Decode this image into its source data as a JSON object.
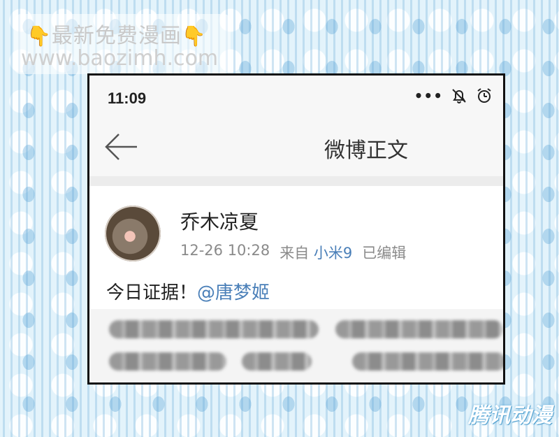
{
  "watermark": {
    "line1": "最新免费漫画",
    "line2": "www.baozimh.com",
    "icon": "pointing-down-hand"
  },
  "status": {
    "time": "11:09",
    "icons": [
      "more-dots-icon",
      "alarm-off-icon",
      "alarm-icon"
    ]
  },
  "nav": {
    "title": "微博正文",
    "back_icon": "back-arrow-icon"
  },
  "post": {
    "username": "乔木凉夏",
    "timestamp": "12-26 10:28",
    "source_prefix": "来自",
    "device": "小米9",
    "edited": "已编辑",
    "text": "今日证据！",
    "mention": "@唐梦姬"
  },
  "corner_logo": "腾讯动漫",
  "colors": {
    "link": "#4a7fb8",
    "bar": "#f7f7f7",
    "frame": "#111111"
  }
}
